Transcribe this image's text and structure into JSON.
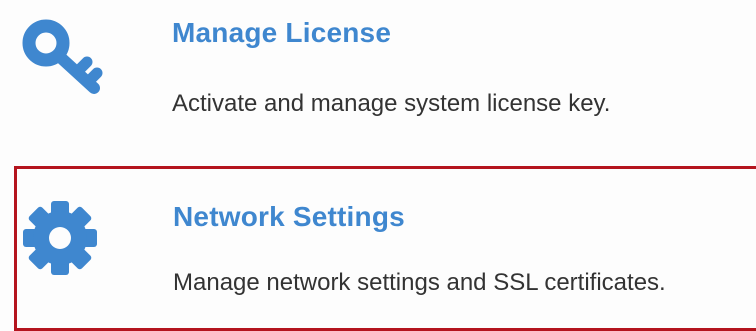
{
  "items": [
    {
      "title": "Manage License",
      "description": "Activate and manage system license key.",
      "icon": "key-icon"
    },
    {
      "title": "Network Settings",
      "description": "Manage network settings and SSL certificates.",
      "icon": "gear-icon"
    }
  ],
  "colors": {
    "title": "#3f87cf",
    "icon": "#3f87cf",
    "description": "#333333",
    "highlight_border": "#b4141e",
    "background": "#fdfdfd"
  }
}
